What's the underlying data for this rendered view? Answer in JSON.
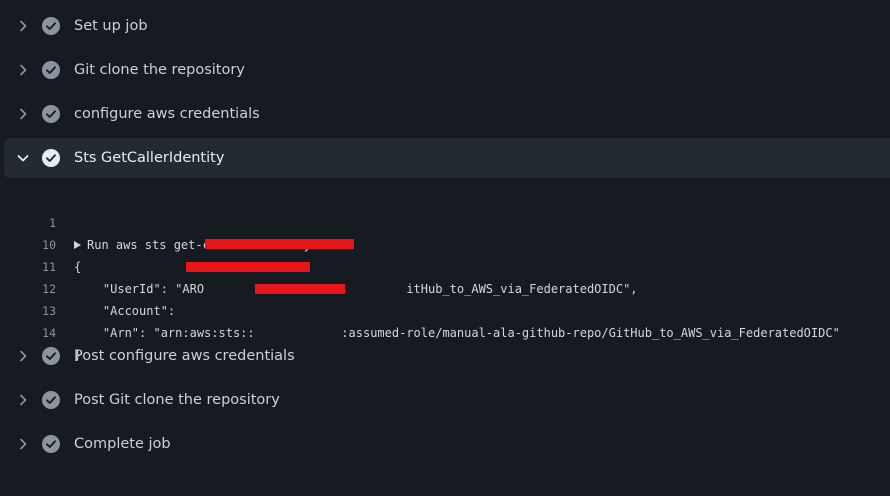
{
  "steps_before": [
    {
      "label": "Set up job",
      "status": "success"
    },
    {
      "label": "Git clone the repository",
      "status": "success"
    },
    {
      "label": "configure aws credentials",
      "status": "success"
    }
  ],
  "active_step": {
    "label": "Sts GetCallerIdentity",
    "status": "success",
    "expanded": true
  },
  "log": {
    "lines": [
      {
        "num": "1",
        "text": "Run aws sts get-caller-identity",
        "collapsible": true
      },
      {
        "num": "10",
        "text": "{"
      },
      {
        "num": "11",
        "text": "    \"UserId\": \"ARO                            itHub_to_AWS_via_FederatedOIDC\","
      },
      {
        "num": "12",
        "text": "    \"Account\": "
      },
      {
        "num": "13",
        "text": "    \"Arn\": \"arn:aws:sts::            :assumed-role/manual-ala-github-repo/GitHub_to_AWS_via_FederatedOIDC\""
      },
      {
        "num": "14",
        "text": "}"
      }
    ]
  },
  "steps_after": [
    {
      "label": "Post configure aws credentials",
      "status": "success"
    },
    {
      "label": "Post Git clone the repository",
      "status": "success"
    },
    {
      "label": "Complete job",
      "status": "success"
    }
  ],
  "colors": {
    "background": "#161b22",
    "active_row": "#242a31",
    "check_circle": "#8b949e",
    "redaction": "#e8151b"
  },
  "icons": {
    "collapsed": "chevron-right-icon",
    "expanded": "chevron-down-icon",
    "status": "check-circle-icon"
  }
}
